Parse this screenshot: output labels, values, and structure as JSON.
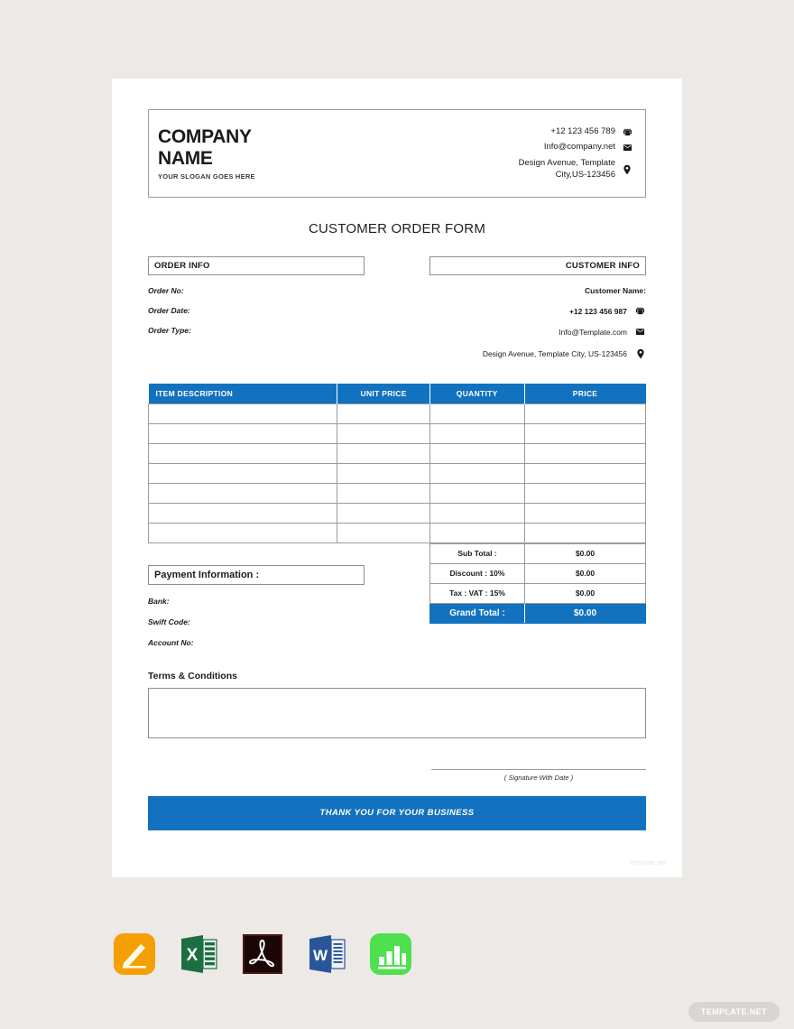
{
  "document": {
    "title": "CUSTOMER ORDER FORM"
  },
  "letterhead": {
    "company_name": "COMPANY\nNAME",
    "slogan": "YOUR SLOGAN GOES HERE",
    "contacts": [
      {
        "icon": "telephone-icon",
        "text": "+12 123 456 789"
      },
      {
        "icon": "envelope-icon",
        "text": "Info@company.net"
      },
      {
        "icon": "location-pin-icon",
        "text": "Design Avenue, Template\nCity,US-123456"
      }
    ]
  },
  "order_info": {
    "heading": "ORDER INFO",
    "fields": [
      {
        "label": "Order No:"
      },
      {
        "label": "Order Date:"
      },
      {
        "label": "Order Type:"
      }
    ]
  },
  "customer_info": {
    "heading": "CUSTOMER INFO",
    "name_label": "Customer Name:",
    "contacts": [
      {
        "icon": "telephone-icon",
        "text": "+12 123 456 987"
      },
      {
        "icon": "envelope-icon",
        "text": "Info@Template.com"
      },
      {
        "icon": "location-pin-icon",
        "text": "Design Avenue, Template City, US-123456"
      }
    ]
  },
  "items_table": {
    "columns": [
      "ITEM DESCRIPTION",
      "UNIT PRICE",
      "QUANTITY",
      "PRICE"
    ],
    "row_count": 7,
    "rows": [
      [
        "",
        "",
        "",
        ""
      ],
      [
        "",
        "",
        "",
        ""
      ],
      [
        "",
        "",
        "",
        ""
      ],
      [
        "",
        "",
        "",
        ""
      ],
      [
        "",
        "",
        "",
        ""
      ],
      [
        "",
        "",
        "",
        ""
      ],
      [
        "",
        "",
        "",
        ""
      ]
    ]
  },
  "payment": {
    "heading": "Payment Information :",
    "fields": [
      {
        "label": "Bank:"
      },
      {
        "label": "Swift Code:"
      },
      {
        "label": "Account No:"
      }
    ]
  },
  "totals": {
    "rows": [
      {
        "label": "Sub Total :",
        "value": "$0.00"
      },
      {
        "label": "Discount : 10%",
        "value": "$0.00"
      },
      {
        "label": "Tax : VAT : 15%",
        "value": "$0.00"
      }
    ],
    "grand": {
      "label": "Grand Total :",
      "value": "$0.00"
    }
  },
  "terms": {
    "heading": "Terms & Conditions",
    "body": ""
  },
  "signature": {
    "caption": "( Signature With Date )"
  },
  "footer_banner": {
    "text": "THANK YOU FOR YOUR BUSINESS"
  },
  "watermark": {
    "text": "Template.net"
  },
  "app_icons": [
    {
      "name": "apple-pages-icon",
      "label": "Pages"
    },
    {
      "name": "microsoft-excel-icon",
      "label": "Excel"
    },
    {
      "name": "adobe-pdf-icon",
      "label": "PDF"
    },
    {
      "name": "microsoft-word-icon",
      "label": "Word"
    },
    {
      "name": "apple-numbers-icon",
      "label": "Numbers"
    }
  ],
  "badge": {
    "text": "TEMPLATE.NET"
  },
  "colors": {
    "accent_blue": "#1272bf",
    "page_background": "#ece9e6",
    "sheet": "#ffffff",
    "border_gray": "#9b9b9b",
    "text": "#1b1b1b"
  }
}
